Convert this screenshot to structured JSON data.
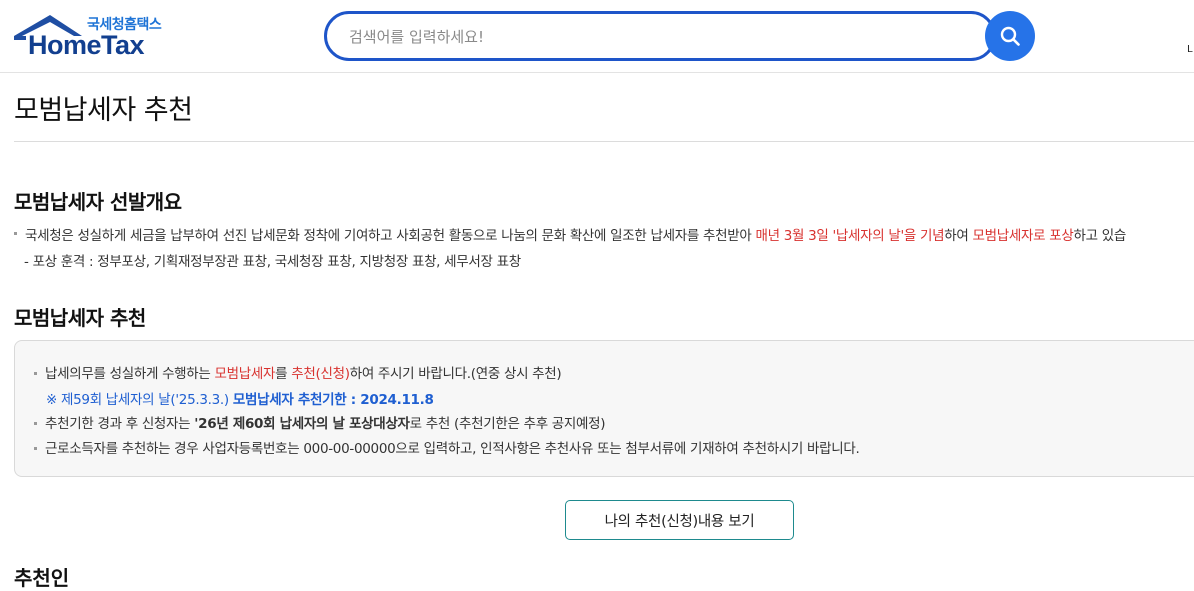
{
  "header": {
    "logo_sub": "국세청홈택스",
    "logo_main": "HomeTax",
    "search_placeholder": "검색어를 입력하세요!",
    "edge_text": "L"
  },
  "page": {
    "title": "모범납세자 추천"
  },
  "overview": {
    "heading": "모범납세자 선발개요",
    "line1_a": "국세청은 성실하게 세금을 납부하여 선진 납세문화 정착에 기여하고 사회공헌 활동으로 나눔의 문화 확산에 일조한 납세자를 추천받아 ",
    "line1_red1": "매년 3월 3일 '납세자의 날'을 기념",
    "line1_b": "하여 ",
    "line1_red2": "모범납세자로 포상",
    "line1_c": "하고 있습",
    "line2": "- 포상 훈격 : 정부포상, 기획재정부장관 표창, 국세청장 표창, 지방청장 표창, 세무서장 표창"
  },
  "recommend": {
    "heading": "모범납세자 추천",
    "n1_a": "납세의무를 성실하게 수행하는 ",
    "n1_red1": "모범납세자",
    "n1_b": "를 ",
    "n1_red2": "추천(신청)",
    "n1_c": "하여 주시기 바랍니다.(연중 상시 추천)",
    "n2_a": "※ 제59회 납세자의 날('25.3.3.) ",
    "n2_bold": "모범납세자 추천기한 : 2024.11.8",
    "n3_a": "추천기한 경과 후 신청자는 ",
    "n3_bold": "'26년 제60회 납세자의 날 포상대상자",
    "n3_b": "로 추천 (추천기한은 추후 공지예정)",
    "n4": "근로소득자를 추천하는 경우 사업자등록번호는 000-00-00000으로 입력하고, 인적사항은 추천사유 또는 첨부서류에 기재하여 추천하시기 바랍니다.",
    "view_button": "나의 추천(신청)내용 보기"
  },
  "next_heading": "추천인",
  "colors": {
    "accent": "#1e55c9",
    "search_button": "#2673e8",
    "highlight_red": "#d8322f",
    "highlight_blue": "#1f5fd1",
    "button_border": "#1e8a8e"
  }
}
